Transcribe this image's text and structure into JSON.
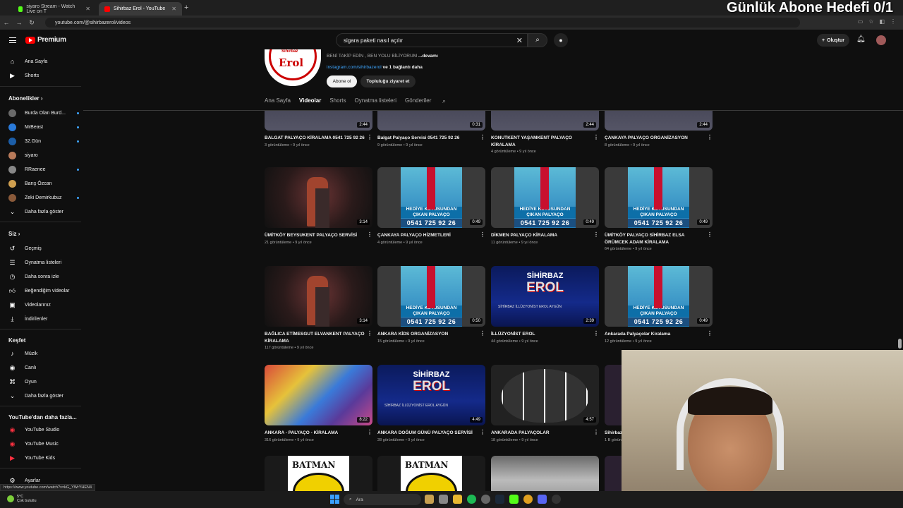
{
  "browser": {
    "tabs": [
      {
        "label": "siyaro Stream - Watch Live on T",
        "color": "#53fc18"
      },
      {
        "label": "Sihirbaz Erol - YouTube",
        "color": "#ff0000"
      }
    ],
    "url": "youtube.com/@sihirbazerol/videos"
  },
  "overlay_text": "Günlük Abone Hedefi 0/1",
  "header": {
    "logo_text": "Premium",
    "search_value": "sigara paketi nasıl açılır",
    "create_label": "Oluştur"
  },
  "sidebar": {
    "main": [
      {
        "label": "Ana Sayfa",
        "icon": "home-icon"
      },
      {
        "label": "Shorts",
        "icon": "shorts-icon"
      }
    ],
    "subs_title": "Abonelikler",
    "subs": [
      {
        "label": "Burda Olan Burd...",
        "color": "#6a6a6a",
        "dot": true
      },
      {
        "label": "MrBeast",
        "color": "#2a7ad9",
        "dot": true
      },
      {
        "label": "32.Gün",
        "color": "#1c5ea8",
        "dot": true
      },
      {
        "label": "siyaro",
        "color": "#b87a5a",
        "dot": false
      },
      {
        "label": "RRaenee",
        "color": "#888888",
        "dot": true
      },
      {
        "label": "Barış Özcan",
        "color": "#d0a050",
        "dot": false
      },
      {
        "label": "Zeki Demirkubuz",
        "color": "#8a5a3a",
        "dot": true
      }
    ],
    "subs_more": "Daha fazla göster",
    "you_title": "Siz",
    "you": [
      {
        "label": "Geçmiş",
        "icon": "history-icon"
      },
      {
        "label": "Oynatma listeleri",
        "icon": "playlist-icon"
      },
      {
        "label": "Daha sonra izle",
        "icon": "clock-icon"
      },
      {
        "label": "Beğendiğim videolar",
        "icon": "like-icon"
      },
      {
        "label": "Videolarınız",
        "icon": "your-videos-icon"
      },
      {
        "label": "İndirilenler",
        "icon": "download-icon"
      }
    ],
    "explore_title": "Keşfet",
    "explore": [
      {
        "label": "Müzik",
        "icon": "music-icon"
      },
      {
        "label": "Canlı",
        "icon": "live-icon"
      },
      {
        "label": "Oyun",
        "icon": "gaming-icon"
      },
      {
        "label": "Daha fazla göster",
        "icon": "chevron-down-icon"
      }
    ],
    "more_title": "YouTube'dan daha fazla...",
    "more": [
      {
        "label": "YouTube Studio"
      },
      {
        "label": "YouTube Music"
      },
      {
        "label": "YouTube Kids"
      }
    ],
    "settings": "Ayarlar"
  },
  "channel": {
    "logo_tag": "Sihirbaz",
    "logo_name": "Erol",
    "desc": "BENİ TAKİP EDİN , BEN YOLU BİLİYORUM",
    "desc_more": "...devamı",
    "link": "instagram.com/sihirbazerol",
    "link_more": "ve 1 bağlantı daha",
    "subscribe": "Abone ol",
    "community": "Topluluğu ziyaret et",
    "tabs": [
      "Ana Sayfa",
      "Videolar",
      "Shorts",
      "Oynatma listeleri",
      "Gönderiler"
    ]
  },
  "videos": [
    {
      "title": "BALGAT PALYAÇO KİRALAMA 0541 725 92 26",
      "meta": "3 görüntüleme • 9 yıl önce",
      "dur": "2:44",
      "thumb": "t-topdark"
    },
    {
      "title": "Balgat Palyaço Servisi 0541 725 92 26",
      "meta": "9 görüntüleme • 9 yıl önce",
      "dur": "0:31",
      "thumb": "t-topdark"
    },
    {
      "title": "KONUTKENT YAŞAMKENT PALYAÇO KİRALAMA",
      "meta": "4 görüntüleme • 9 yıl önce",
      "dur": "2:44",
      "thumb": "t-topdark"
    },
    {
      "title": "ÇANKAYA PALYAÇO ORGANİZASYON",
      "meta": "8 görüntüleme • 9 yıl önce",
      "dur": "2:44",
      "thumb": "t-topdark"
    },
    {
      "title": "ÜMİTKÖY BEYSUKENT PALYAÇO SERVİSİ",
      "meta": "21 görüntüleme • 9 yıl önce",
      "dur": "3:14",
      "thumb": "t-batman"
    },
    {
      "title": "ÇANKAYA PALYAÇO HİZMETLERİ",
      "meta": "4 görüntüleme • 9 yıl önce",
      "dur": "0:49",
      "thumb": "t-gift"
    },
    {
      "title": "DİKMEN PALYAÇO KİRALAMA",
      "meta": "11 görüntüleme • 9 yıl önce",
      "dur": "0:49",
      "thumb": "t-gift"
    },
    {
      "title": "ÜMİTKÖY PALYAÇO SİHİRBAZ ELSA ÖRÜMCEK ADAM KİRALAMA",
      "meta": "64 görüntüleme • 9 yıl önce",
      "dur": "0:49",
      "thumb": "t-gift"
    },
    {
      "title": "BAĞLICA ETİMESGUT ELVANKENT PALYAÇO KİRALAMA",
      "meta": "117 görüntüleme • 9 yıl önce",
      "dur": "3:14",
      "thumb": "t-batman"
    },
    {
      "title": "ANKARA KİDS ORGANİZASYON",
      "meta": "15 görüntüleme • 9 yıl önce",
      "dur": "0:50",
      "thumb": "t-gift"
    },
    {
      "title": "İLLÜZYONİST EROL",
      "meta": "44 görüntüleme • 9 yıl önce",
      "dur": "2:39",
      "thumb": "t-erol"
    },
    {
      "title": "Ankarada Palyaçolar Kiralama",
      "meta": "12 görüntüleme • 9 yıl önce",
      "dur": "0:49",
      "thumb": "t-gift"
    },
    {
      "title": "ANKARA - PALYAÇO - KİRALAMA",
      "meta": "316 görüntüleme • 9 yıl önce",
      "dur": "8:22",
      "thumb": "t-clown"
    },
    {
      "title": "ANKARA DOĞUM GÜNÜ PALYAÇO SERVİSİ",
      "meta": "28 görüntüleme • 9 yıl önce",
      "dur": "4:49",
      "thumb": "t-erol"
    },
    {
      "title": "ANKARADA PALYAÇOLAR",
      "meta": "18 görüntüleme • 9 yıl önce",
      "dur": "4:57",
      "thumb": "t-heart"
    },
    {
      "title": "Sihirbaz",
      "meta": "1 B görün",
      "dur": "",
      "thumb": "t-dark"
    },
    {
      "title": "",
      "meta": "",
      "dur": "",
      "thumb": "t-bat2"
    },
    {
      "title": "",
      "meta": "",
      "dur": "",
      "thumb": "t-bat2"
    },
    {
      "title": "",
      "meta": "",
      "dur": "",
      "thumb": "t-room"
    },
    {
      "title": "",
      "meta": "",
      "dur": "",
      "thumb": "t-dark"
    }
  ],
  "gift": {
    "line1": "HEDİYE KUTUSUNDAN",
    "line2": "ÇIKAN PALYAÇO",
    "phone": "0541 725 92 26"
  },
  "erol": {
    "top": "SİHİRBAZ",
    "name": "EROL",
    "sub": "SİHİRBAZ İLLÜZYONİST EROL AYGÜN"
  },
  "status_url": "https://www.youtube.com/watch?v=kG_YWrYHEN4",
  "taskbar": {
    "temp": "5°C",
    "weather": "Çok bulutlu",
    "search": "Ara"
  }
}
